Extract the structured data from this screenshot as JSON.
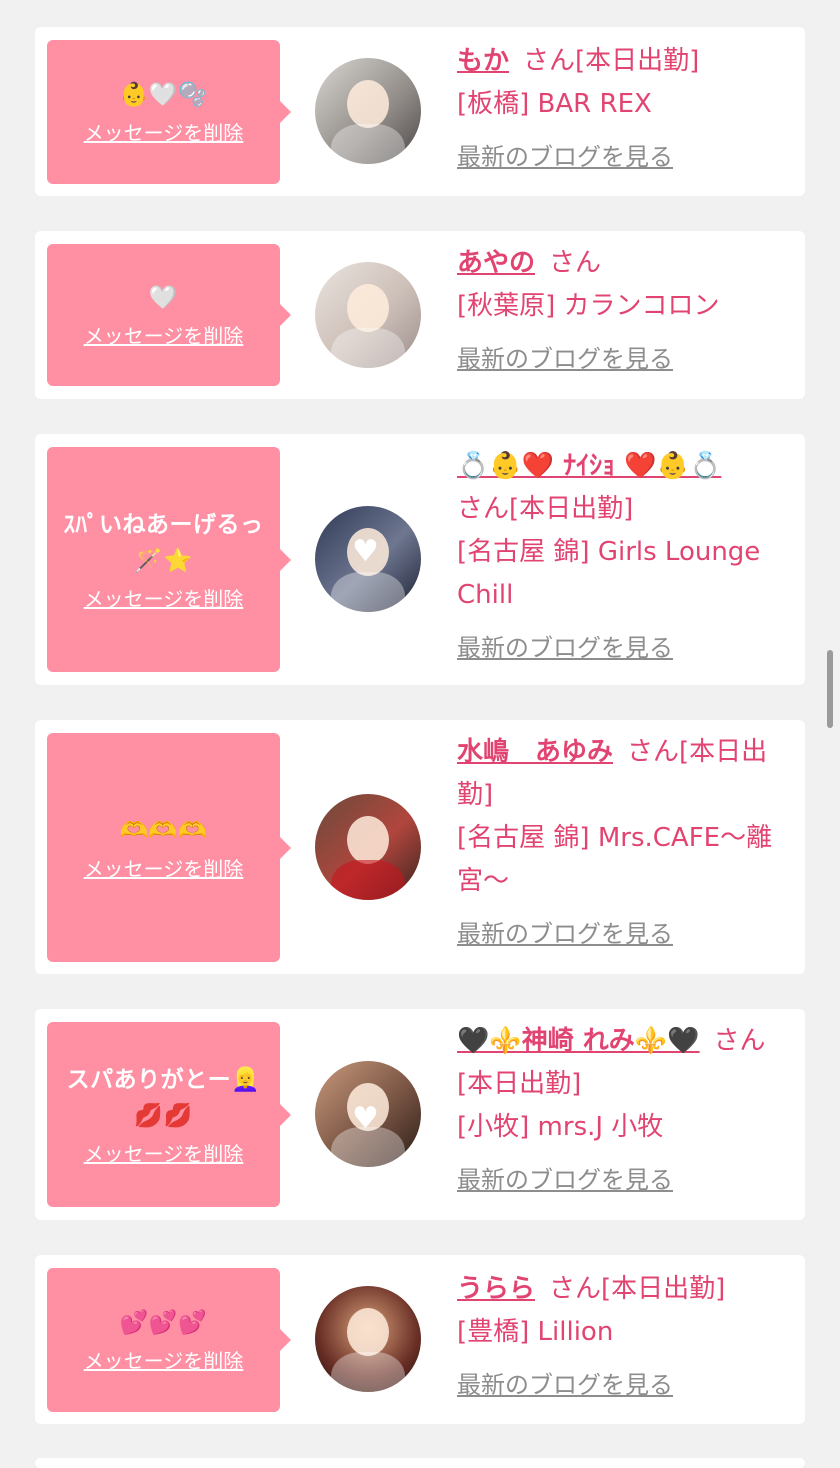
{
  "delete_label": "メッセージを削除",
  "blog_label": "最新のブログを見る",
  "san": "さん",
  "colors": {
    "bubble": "#ff8fa3",
    "accent": "#e24471",
    "muted": "#8d8d8d",
    "background": "#f1f1f2"
  },
  "cards": [
    {
      "message": "👶🤍🫧",
      "name": "もか",
      "status": "[本日出勤]",
      "shop": "[板橋] BAR REX",
      "avatar_icon": "avatar-photo"
    },
    {
      "message": "🤍",
      "name": "あやの",
      "status": "",
      "shop": "[秋葉原] カランコロン",
      "avatar_icon": "avatar-photo"
    },
    {
      "message": "ｽﾊﾟいねあーげるっ🪄⭐",
      "name": "💍👶❤️ ﾅｲｼｮ ❤️👶💍",
      "status": "[本日出勤]",
      "shop": "[名古屋 錦] Girls Lounge Chill",
      "avatar_icon": "avatar-photo"
    },
    {
      "message": "🫶🫶🫶",
      "name": "水嶋　あゆみ",
      "status": "[本日出勤]",
      "shop": "[名古屋 錦] Mrs.CAFE～離宮～",
      "avatar_icon": "avatar-photo"
    },
    {
      "message": "スパありがとー👱‍♀️💋💋",
      "name": "🖤⚜️神崎 れみ⚜️🖤",
      "status": "[本日出勤]",
      "shop": "[小牧] mrs.J 小牧",
      "avatar_icon": "avatar-photo"
    },
    {
      "message": "💕💕💕",
      "name": "うらら",
      "status": "[本日出勤]",
      "shop": "[豊橋] Lillion",
      "avatar_icon": "avatar-photo"
    }
  ]
}
